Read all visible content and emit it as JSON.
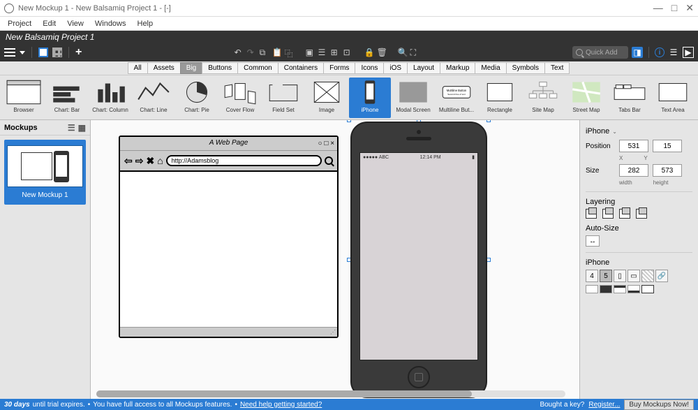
{
  "window": {
    "title": "New Mockup 1 - New Balsamiq Project 1 - [-]"
  },
  "menu": [
    "Project",
    "Edit",
    "View",
    "Windows",
    "Help"
  ],
  "project_name": "New Balsamiq Project 1",
  "quick_add_placeholder": "Quick Add",
  "categories": [
    "All",
    "Assets",
    "Big",
    "Buttons",
    "Common",
    "Containers",
    "Forms",
    "Icons",
    "iOS",
    "Layout",
    "Markup",
    "Media",
    "Symbols",
    "Text"
  ],
  "active_category": "Big",
  "gallery": [
    {
      "label": "Browser"
    },
    {
      "label": "Chart: Bar"
    },
    {
      "label": "Chart: Column"
    },
    {
      "label": "Chart: Line"
    },
    {
      "label": "Chart: Pie"
    },
    {
      "label": "Cover Flow"
    },
    {
      "label": "Field Set"
    },
    {
      "label": "Image"
    },
    {
      "label": "iPhone"
    },
    {
      "label": "Modal Screen"
    },
    {
      "label": "Multiline But..."
    },
    {
      "label": "Rectangle"
    },
    {
      "label": "Site Map"
    },
    {
      "label": "Street Map"
    },
    {
      "label": "Tabs Bar"
    },
    {
      "label": "Text Area"
    }
  ],
  "selected_gallery": "iPhone",
  "mockups_panel": {
    "title": "Mockups",
    "items": [
      {
        "name": "New Mockup 1"
      }
    ]
  },
  "canvas": {
    "browser": {
      "title": "A Web Page",
      "url": "http://Adamsblog"
    },
    "iphone": {
      "carrier": "●●●●● ABC",
      "time": "12:14 PM",
      "battery": "▮"
    }
  },
  "properties": {
    "component": "iPhone",
    "position_label": "Position",
    "position": {
      "x": "531",
      "y": "15"
    },
    "pos_sublabels": {
      "x": "X",
      "y": "Y"
    },
    "size_label": "Size",
    "size": {
      "w": "282",
      "h": "573"
    },
    "size_sublabels": {
      "w": "width",
      "h": "height"
    },
    "layering_label": "Layering",
    "autosize_label": "Auto-Size",
    "iphone_label": "iPhone",
    "iphone_variants": [
      "4",
      "5"
    ]
  },
  "status": {
    "days": "30 days",
    "trial_text": "until trial expires.",
    "full_access": "You have full access to all Mockups features.",
    "help_link": "Need help getting started?",
    "bought_key": "Bought a key?",
    "register": "Register...",
    "buy": "Buy Mockups Now!"
  }
}
